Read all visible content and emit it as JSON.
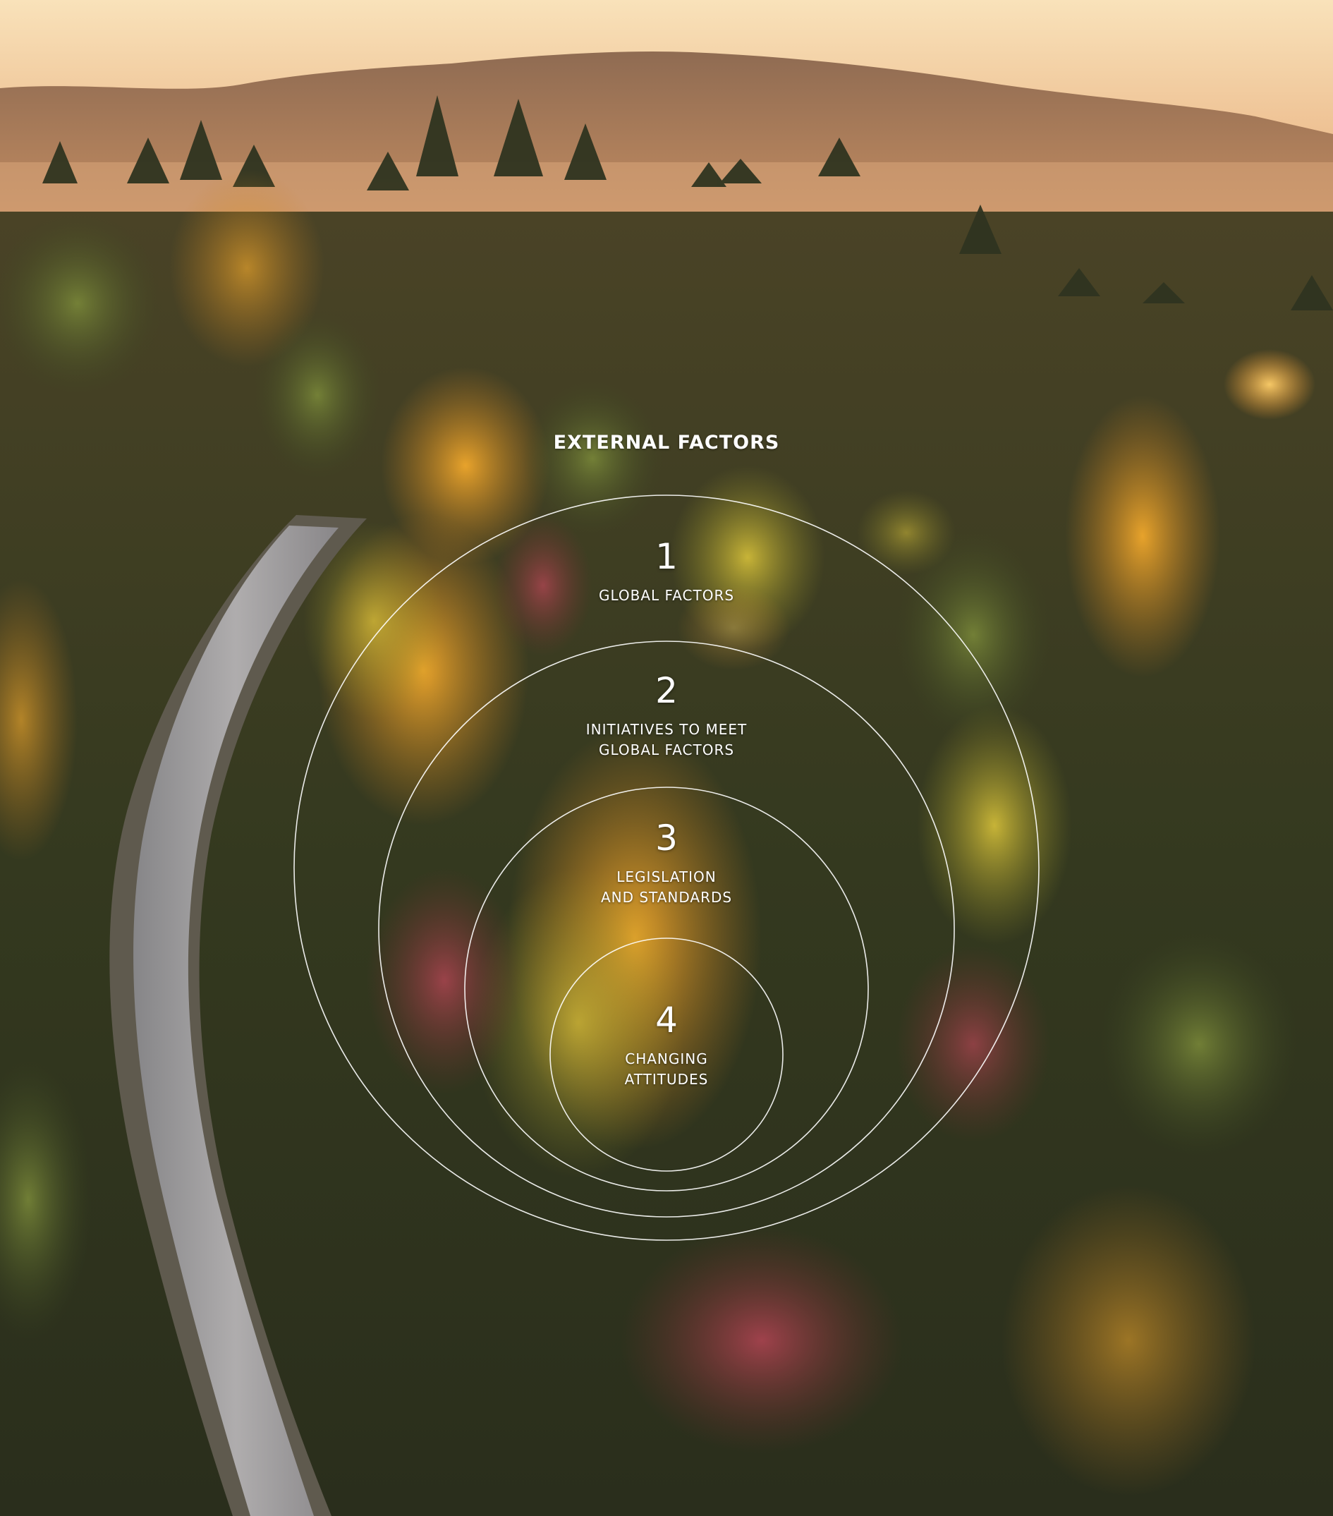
{
  "title": "EXTERNAL FACTORS",
  "factors": [
    {
      "number": "1",
      "label_lines": [
        "GLOBAL FACTORS"
      ]
    },
    {
      "number": "2",
      "label_lines": [
        "INITIATIVES TO MEET",
        "GLOBAL FACTORS"
      ]
    },
    {
      "number": "3",
      "label_lines": [
        "LEGISLATION",
        "AND STANDARDS"
      ]
    },
    {
      "number": "4",
      "label_lines": [
        "CHANGING",
        "ATTITUDES"
      ]
    }
  ],
  "colors": {
    "ring_stroke": "#ffffff",
    "text": "#ffffff",
    "sky_top": "#f6d7a8",
    "forest_dark": "#2c3a1f",
    "foliage_orange": "#d99a2b"
  }
}
